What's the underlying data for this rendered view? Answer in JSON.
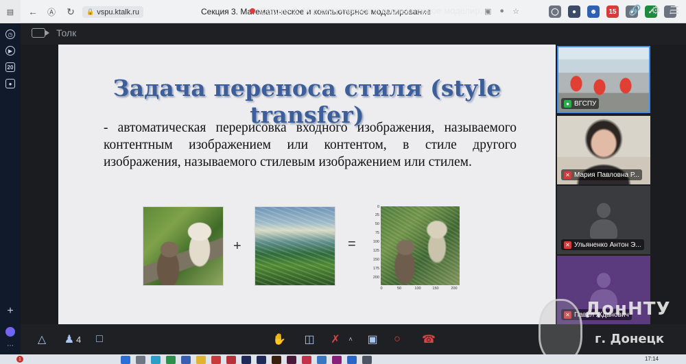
{
  "browser": {
    "url": "vspu.ktalk.ru",
    "tab_title": "Секция 3. Математическое и компьютерное моделирование",
    "back_icon": "arrow-left-icon",
    "yandex_icon": "yandex-icon",
    "reload_icon": "reload-icon",
    "lock_icon": "lock-icon",
    "extensions": [
      {
        "name": "globe-icon",
        "color": "#6b7280"
      },
      {
        "name": "planet-icon",
        "color": "#3b4a66"
      },
      {
        "name": "person-icon",
        "color": "#2f5fb3"
      },
      {
        "name": "calendar-icon",
        "color": "#d93a3a",
        "text": "15"
      },
      {
        "name": "puzzle-icon",
        "color": "#6b7280"
      },
      {
        "name": "shield-icon",
        "color": "#1d8a3e"
      },
      {
        "name": "download-icon",
        "color": "#6b7280"
      }
    ]
  },
  "app": {
    "name": "Толк",
    "meeting_title": "Секция 3. Математическое и компьютерное моделир...",
    "rail_items": [
      "history-icon",
      "play-icon",
      "calendar-20-icon",
      "screen-record-icon"
    ]
  },
  "slide": {
    "title": "Задача переноса стиля (style transfer)",
    "body": "- автоматическая перерисовка входного изображения, называемого контентным изображением или контентом, в стиле другого изображения, называемого стилевым изображением или стилем.",
    "plus": "+",
    "equals": "=",
    "result_axis": {
      "y_ticks": [
        "0",
        "25",
        "50",
        "75",
        "100",
        "125",
        "150",
        "175",
        "200"
      ],
      "x_ticks": [
        "0",
        "50",
        "100",
        "150",
        "200"
      ]
    }
  },
  "participants": [
    {
      "name": "ВГСПУ",
      "mic": "on"
    },
    {
      "name": "Мария Павловна Р...",
      "mic": "off"
    },
    {
      "name": "Ульяненко Антон Э...",
      "mic": "off"
    },
    {
      "name": "Павел Жданович",
      "mic": "off"
    }
  ],
  "toolbar": {
    "participants_count": "4",
    "items": [
      "shapes-icon",
      "participants-icon",
      "chat-icon",
      "raise-hand-icon",
      "screen-share-icon",
      "mic-muted-icon",
      "chevron-up-icon",
      "camera-icon",
      "record-icon",
      "hang-up-icon"
    ]
  },
  "watermark": {
    "big": "ДонНТУ",
    "small": "г. Донецк"
  },
  "taskbar": {
    "clock": "17:14",
    "badge": "1"
  }
}
